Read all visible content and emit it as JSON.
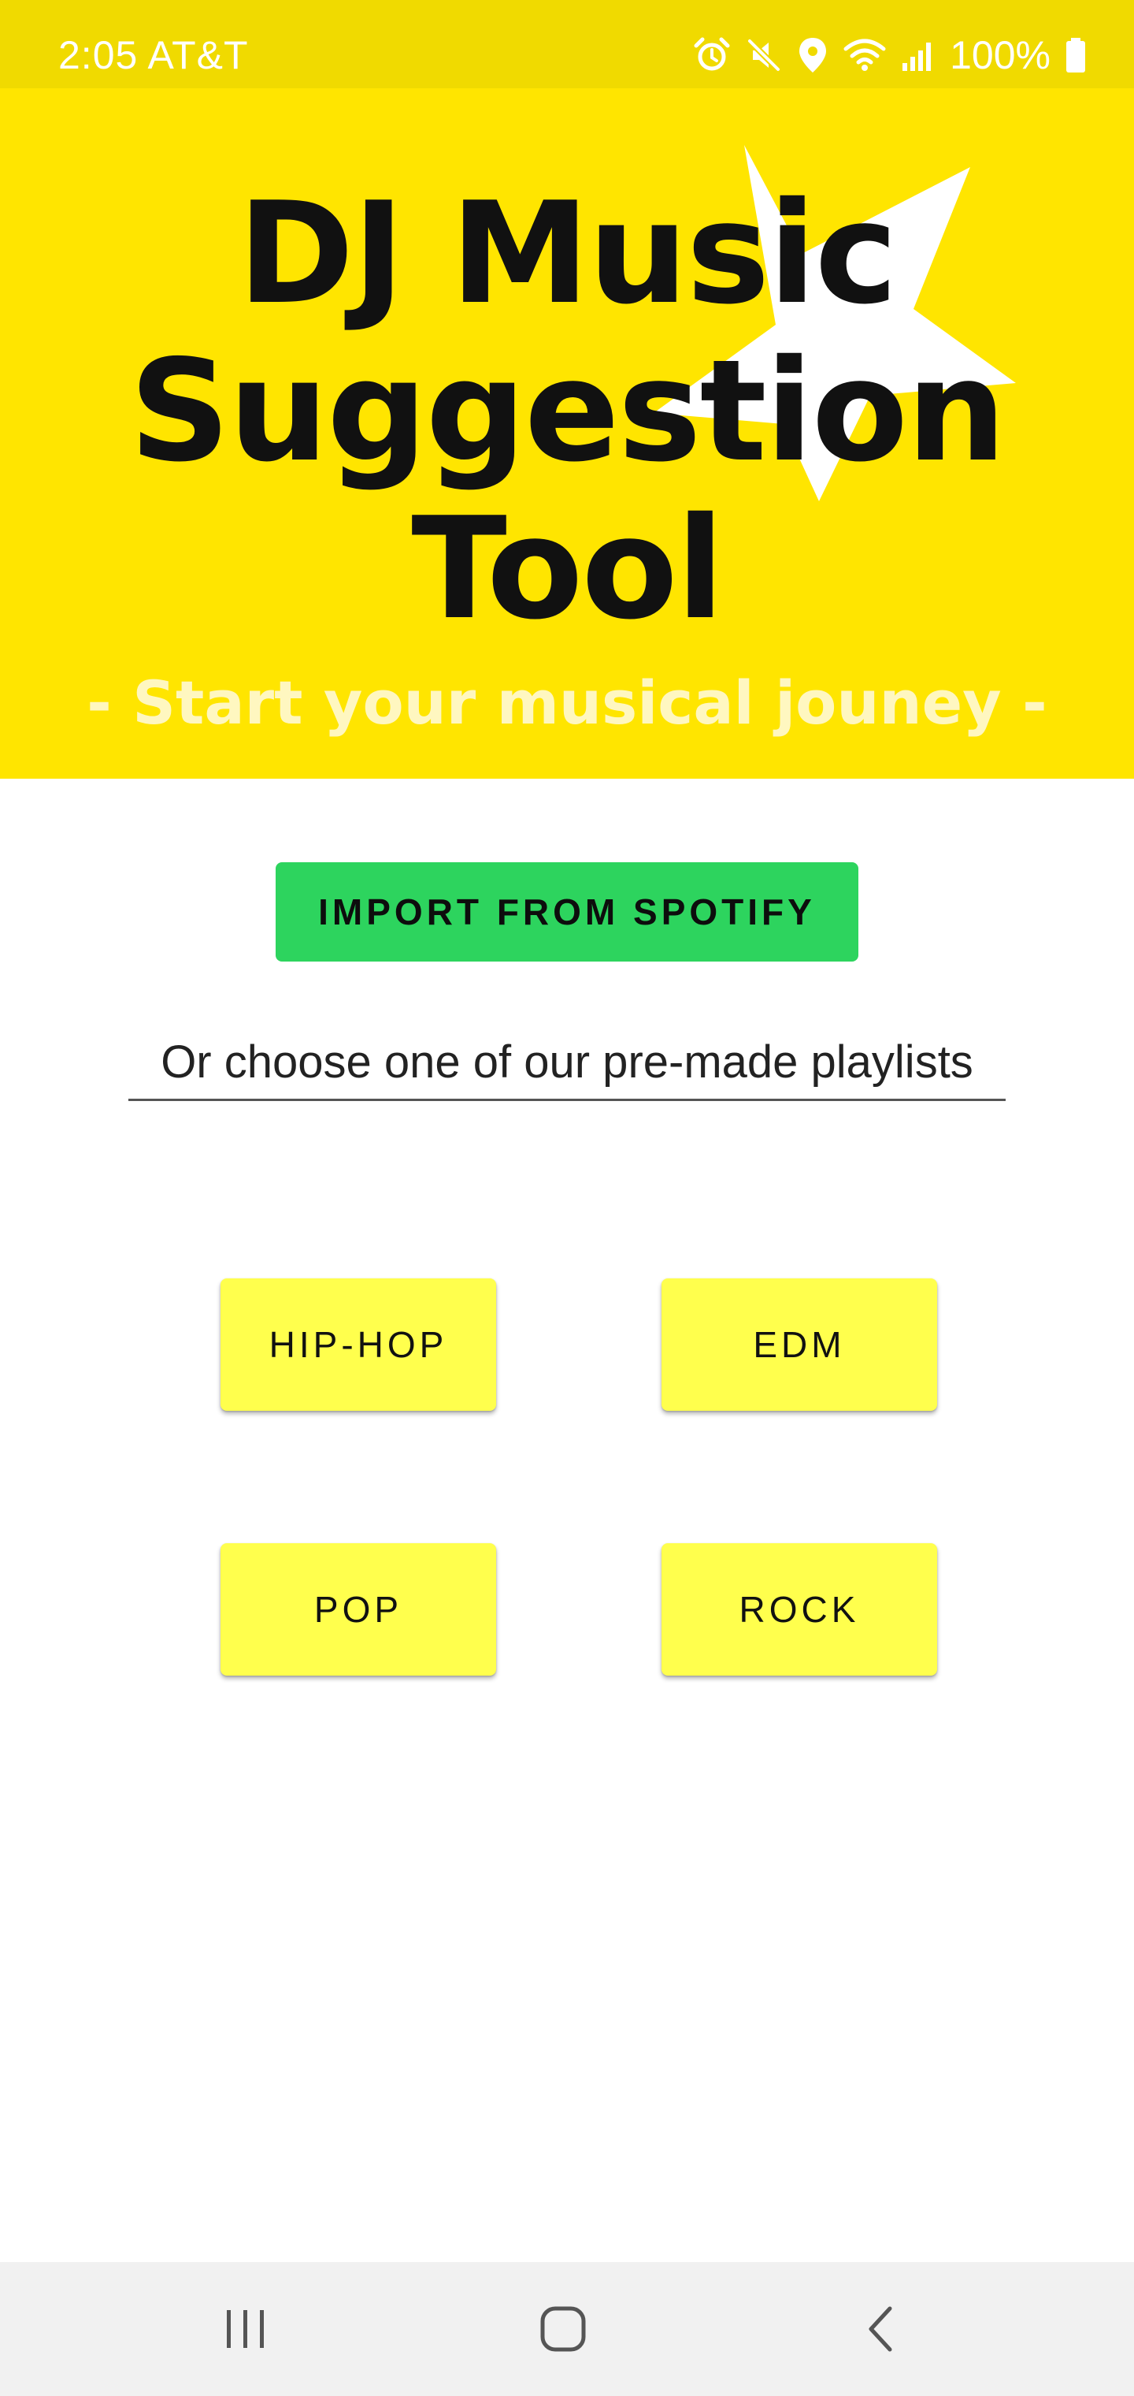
{
  "status_bar": {
    "time_carrier": "2:05 AT&T",
    "battery": "100%",
    "background": "#F0DA00"
  },
  "banner": {
    "title_lines": [
      "DJ Music",
      "Suggestion",
      "Tool"
    ],
    "tagline": "- Start your musical jouney -",
    "background": "#FFE500"
  },
  "import_button": {
    "label": "IMPORT FROM SPOTIFY",
    "color": "#2DD45E"
  },
  "subtitle": "Or choose one of our pre-made playlists",
  "playlists": [
    {
      "label": "HIP-HOP"
    },
    {
      "label": "EDM"
    },
    {
      "label": "POP"
    },
    {
      "label": "ROCK"
    }
  ],
  "playlist_button_color": "#FFFF4D",
  "nav_bar": {
    "icons": [
      "recent-apps-icon",
      "home-icon",
      "back-icon"
    ]
  }
}
